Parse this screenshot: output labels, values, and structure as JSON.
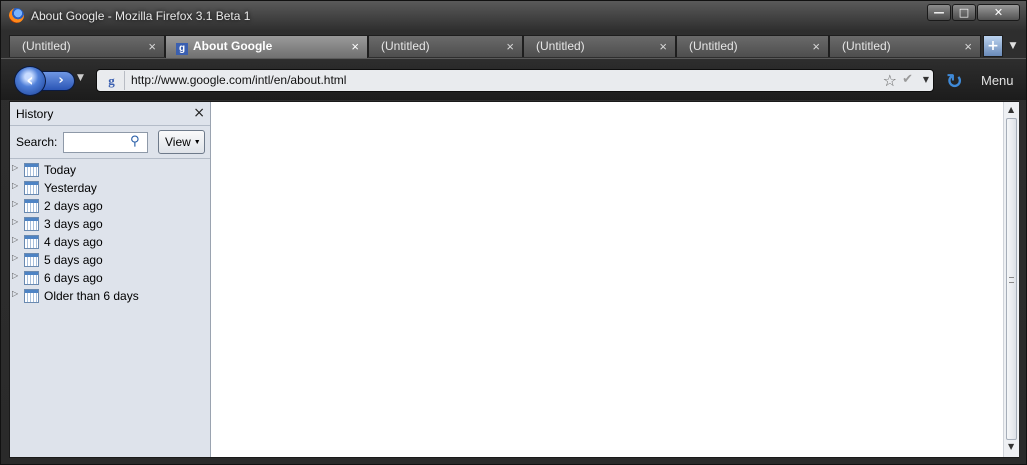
{
  "window": {
    "title": "About Google - Mozilla Firefox 3.1 Beta 1",
    "minimize_glyph": "—",
    "maximize_glyph": "□",
    "close_glyph": "✕"
  },
  "tabs": [
    {
      "label": "(Untitled)",
      "active": false
    },
    {
      "label": "About Google",
      "active": true,
      "favicon": "g"
    },
    {
      "label": "(Untitled)",
      "active": false
    },
    {
      "label": "(Untitled)",
      "active": false
    },
    {
      "label": "(Untitled)",
      "active": false
    },
    {
      "label": "(Untitled)",
      "active": false
    }
  ],
  "tab_close_glyph": "×",
  "newtab_glyph": "+",
  "tablist_glyph": "▼",
  "nav": {
    "back_glyph": "‹",
    "forward_glyph": "›",
    "history_dropdown_glyph": "▼",
    "site_identity": "g",
    "url": "http://www.google.com/intl/en/about.html",
    "star_glyph": "☆",
    "check_glyph": "✔",
    "url_dropdown_glyph": "▼",
    "reload_glyph": "↻",
    "menu_label": "Menu"
  },
  "sidebar": {
    "title": "History",
    "close_glyph": "×",
    "search_label": "Search:",
    "search_value": "",
    "search_glyph": "⚲",
    "view_label": "View",
    "view_caret": "▼",
    "items": [
      {
        "label": "Today"
      },
      {
        "label": "Yesterday"
      },
      {
        "label": "2 days ago"
      },
      {
        "label": "3 days ago"
      },
      {
        "label": "4 days ago"
      },
      {
        "label": "5 days ago"
      },
      {
        "label": "6 days ago"
      },
      {
        "label": "Older than 6 days"
      }
    ],
    "twisty_glyph": "▷"
  },
  "scrollbar": {
    "up_glyph": "▲",
    "down_glyph": "▼"
  }
}
